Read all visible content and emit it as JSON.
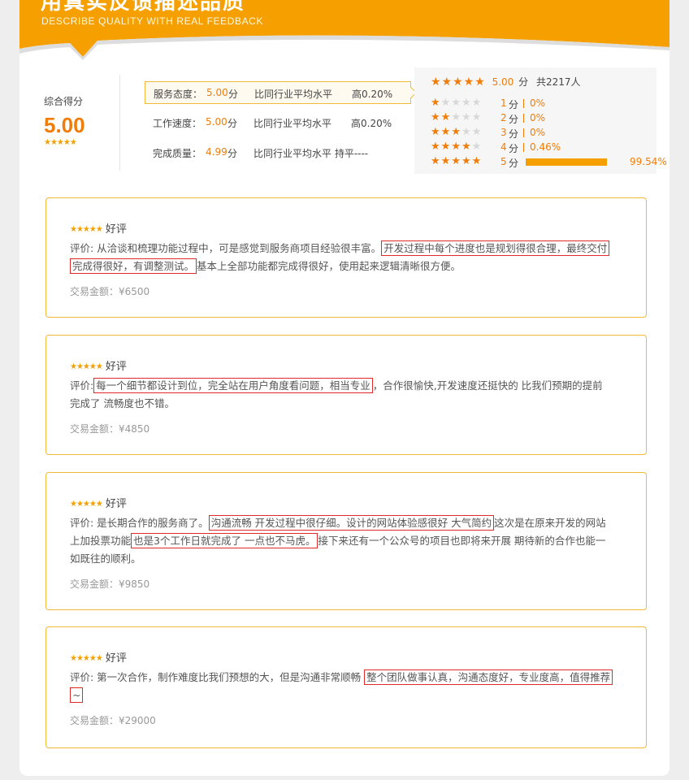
{
  "banner": {
    "title": "用真实反馈描述品质",
    "subtitle": "DESCRIBE QUALITY WITH REAL FEEDBACK",
    "color": "#f5a000"
  },
  "overall": {
    "label": "综合得分",
    "score": "5.00",
    "stars": "★★★★★"
  },
  "metrics": [
    {
      "label": "服务态度：",
      "value": "5.00",
      "unit": "分",
      "compare": "比同行业平均水平",
      "rate": "高0.20%"
    },
    {
      "label": "工作速度：",
      "value": "5.00",
      "unit": "分",
      "compare": "比同行业平均水平",
      "rate": "高0.20%"
    },
    {
      "label": "完成质量：",
      "value": "4.99",
      "unit": "分",
      "compare": "比同行业平均水平 持平----",
      "rate": ""
    }
  ],
  "distribution": {
    "stars": "★★★★★",
    "score": "5.00",
    "unit": "分",
    "total": "共2217人",
    "rows": [
      {
        "level": "1",
        "unit": "分",
        "percent": "0%",
        "filled": 1
      },
      {
        "level": "2",
        "unit": "分",
        "percent": "0%",
        "filled": 2
      },
      {
        "level": "3",
        "unit": "分",
        "percent": "0%",
        "filled": 3
      },
      {
        "level": "4",
        "unit": "分",
        "percent": "0.46%",
        "filled": 4
      },
      {
        "level": "5",
        "unit": "分",
        "percent": "99.54%",
        "filled": 5,
        "bar_fraction": 0.9954
      }
    ]
  },
  "reviews": [
    {
      "stars": "★★★★★",
      "rating": "好评",
      "segments": [
        {
          "text": "评价: 从洽谈和梳理功能过程中，可是感觉到服务商项目经验很丰富。",
          "hl": false
        },
        {
          "text": "开发过程中每个进度也是规划得很合理，最终交付完成得很好，有调整测试。",
          "hl": true
        },
        {
          "text": "基本上全部功能都完成得很好，使用起来逻辑清晰很方便。",
          "hl": false
        }
      ],
      "amount": "交易金额：¥6500"
    },
    {
      "stars": "★★★★★",
      "rating": "好评",
      "segments": [
        {
          "text": "评价:",
          "hl": false
        },
        {
          "text": "每一个细节都设计到位，完全站在用户角度看问题，相当专业",
          "hl": true
        },
        {
          "text": "，合作很愉快,开发速度还挺快的 比我们预期的提前完成了 流畅度也不错。",
          "hl": false
        }
      ],
      "amount": "交易金额：¥4850"
    },
    {
      "stars": "★★★★★",
      "rating": "好评",
      "segments": [
        {
          "text": "评价: 是长期合作的服务商了。",
          "hl": false
        },
        {
          "text": "沟通流畅 开发过程中很仔细。设计的网站体验感很好 大气简约",
          "hl": true
        },
        {
          "text": "这次是在原来开发的网站上加投票功能",
          "hl": false
        },
        {
          "text": "也是3个工作日就完成了 一点也不马虎。",
          "hl": true
        },
        {
          "text": "接下来还有一个公众号的项目也即将来开展 期待新的合作也能一如既往的顺利。",
          "hl": false
        }
      ],
      "amount": "交易金额：¥9850"
    },
    {
      "stars": "★★★★★",
      "rating": "好评",
      "segments": [
        {
          "text": "评价: 第一次合作，制作难度比我们预想的大，但是沟通非常顺畅 ",
          "hl": false
        },
        {
          "text": "整个团队做事认真，沟通态度好，专业度高，值得推荐~",
          "hl": true
        }
      ],
      "amount": "交易金额：¥29000"
    }
  ]
}
